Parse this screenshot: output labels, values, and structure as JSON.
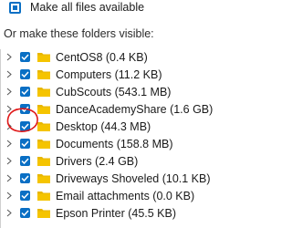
{
  "make_all": {
    "label": "Make all files available"
  },
  "subheading": "Or make these folders visible:",
  "folders": [
    {
      "label": "CentOS8  (0.4 KB)"
    },
    {
      "label": "Computers  (11.2 KB)"
    },
    {
      "label": "CubScouts  (543.1 MB)"
    },
    {
      "label": "DanceAcademyShare  (1.6 GB)"
    },
    {
      "label": "Desktop  (44.3 MB)"
    },
    {
      "label": "Documents  (158.8 MB)"
    },
    {
      "label": "Drivers  (2.4 GB)"
    },
    {
      "label": "Driveways Shoveled  (10.1 KB)"
    },
    {
      "label": "Email attachments  (0.0 KB)"
    },
    {
      "label": "Epson Printer  (45.5 KB)"
    }
  ],
  "colors": {
    "accent": "#0a6fc4",
    "folder": "#e8b600",
    "annotation": "#e01818"
  }
}
